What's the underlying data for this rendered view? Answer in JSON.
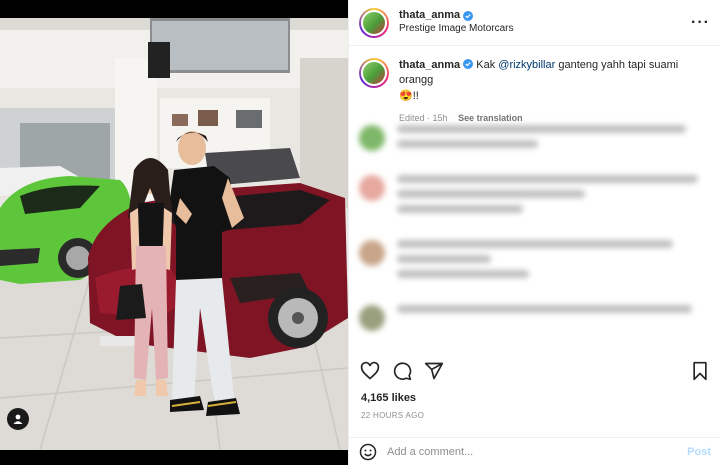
{
  "header": {
    "username": "thata_anma",
    "subtitle": "Prestige Image Motorcars",
    "more_icon": "more-horizontal-icon"
  },
  "caption": {
    "username": "thata_anma",
    "prefix": "Kak ",
    "mention": "@rizkybillar",
    "text": " ganteng yahh tapi suami orangg",
    "emoji": "😍!!",
    "edited": "Edited · 15h",
    "see_translation": "See translation"
  },
  "actions": {
    "like_icon": "heart-icon",
    "comment_icon": "comment-icon",
    "share_icon": "send-icon",
    "save_icon": "bookmark-icon"
  },
  "likes": "4,165 likes",
  "timestamp": "22 HOURS AGO",
  "add_comment": {
    "placeholder": "Add a comment...",
    "post_label": "Post",
    "emoji_icon": "smiley-icon"
  },
  "colors": {
    "mention": "#00376b",
    "post_button_disabled": "#b3dbff",
    "verified": "#3897f0"
  }
}
